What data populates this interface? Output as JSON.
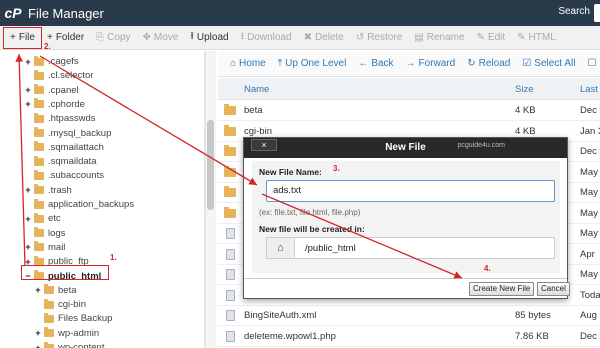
{
  "header": {
    "logo": "cP",
    "title": "File Manager",
    "search_label": "Search"
  },
  "toolbar": {
    "buttons": [
      {
        "icon": "plus-icon",
        "glyph": "+",
        "label": "File",
        "enabled": true
      },
      {
        "icon": "plus-icon",
        "glyph": "+",
        "label": "Folder",
        "enabled": true
      },
      {
        "icon": "copy-icon",
        "glyph": "⎘",
        "label": "Copy",
        "enabled": false
      },
      {
        "icon": "move-icon",
        "glyph": "✥",
        "label": "Move",
        "enabled": false
      },
      {
        "icon": "upload-icon",
        "glyph": "⭱",
        "label": "Upload",
        "enabled": true
      },
      {
        "icon": "download-icon",
        "glyph": "⭳",
        "label": "Download",
        "enabled": false
      },
      {
        "icon": "delete-icon",
        "glyph": "✖",
        "label": "Delete",
        "enabled": false
      },
      {
        "icon": "restore-icon",
        "glyph": "↺",
        "label": "Restore",
        "enabled": false
      },
      {
        "icon": "rename-icon",
        "glyph": "▤",
        "label": "Rename",
        "enabled": false
      },
      {
        "icon": "edit-icon",
        "glyph": "✎",
        "label": "Edit",
        "enabled": false
      },
      {
        "icon": "html-editor-icon",
        "glyph": "✎",
        "label": "HTML",
        "enabled": false
      }
    ]
  },
  "sidebar": {
    "items": [
      {
        "label": ".cagefs",
        "expander": "+",
        "depth": 1
      },
      {
        "label": ".cl.selector",
        "expander": "",
        "depth": 1
      },
      {
        "label": ".cpanel",
        "expander": "+",
        "depth": 1
      },
      {
        "label": ".cphorde",
        "expander": "+",
        "depth": 1
      },
      {
        "label": ".htpasswds",
        "expander": "",
        "depth": 1
      },
      {
        "label": ".mysql_backup",
        "expander": "",
        "depth": 1
      },
      {
        "label": ".sqmailattach",
        "expander": "",
        "depth": 1
      },
      {
        "label": ".sqmaildata",
        "expander": "",
        "depth": 1
      },
      {
        "label": ".subaccounts",
        "expander": "",
        "depth": 1
      },
      {
        "label": ".trash",
        "expander": "+",
        "depth": 1
      },
      {
        "label": "application_backups",
        "expander": "",
        "depth": 1
      },
      {
        "label": "etc",
        "expander": "+",
        "depth": 1
      },
      {
        "label": "logs",
        "expander": "",
        "depth": 1
      },
      {
        "label": "mail",
        "expander": "+",
        "depth": 1
      },
      {
        "label": "public_ftp",
        "expander": "+",
        "depth": 1
      },
      {
        "label": "public_html",
        "expander": "−",
        "depth": 1,
        "selected": true
      },
      {
        "label": "beta",
        "expander": "+",
        "depth": 2
      },
      {
        "label": "cgi-bin",
        "expander": "",
        "depth": 2
      },
      {
        "label": "Files Backup",
        "expander": "",
        "depth": 2
      },
      {
        "label": "wp-admin",
        "expander": "+",
        "depth": 2
      },
      {
        "label": "wp-content",
        "expander": "+",
        "depth": 2
      }
    ]
  },
  "navbar": {
    "buttons": [
      {
        "icon": "home-icon",
        "glyph": "⌂",
        "label": "Home"
      },
      {
        "icon": "up-one-level-icon",
        "glyph": "⤒",
        "label": "Up One Level"
      },
      {
        "icon": "back-arrow-icon",
        "glyph": "←",
        "label": "Back"
      },
      {
        "icon": "forward-arrow-icon",
        "glyph": "→",
        "label": "Forward"
      },
      {
        "icon": "reload-icon",
        "glyph": "↻",
        "label": "Reload"
      },
      {
        "icon": "select-all-icon",
        "glyph": "☑",
        "label": "Select All"
      },
      {
        "icon": "unselect-icon",
        "glyph": "☐",
        "label": ""
      }
    ]
  },
  "table": {
    "columns": {
      "name": "Name",
      "size": "Size",
      "date": "Last"
    },
    "rows": [
      {
        "type": "folder",
        "name": "beta",
        "size": "4 KB",
        "date": "Dec"
      },
      {
        "type": "folder",
        "name": "cgi-bin",
        "size": "4 KB",
        "date": "Jan 3"
      },
      {
        "type": "folder",
        "name": "",
        "size": "",
        "date": "Dec"
      },
      {
        "type": "folder",
        "name": "",
        "size": "",
        "date": "May"
      },
      {
        "type": "folder",
        "name": "",
        "size": "",
        "date": "May"
      },
      {
        "type": "folder",
        "name": "",
        "size": "",
        "date": "May"
      },
      {
        "type": "file",
        "name": "",
        "size": "",
        "date": "May"
      },
      {
        "type": "file",
        "name": "",
        "size": "",
        "date": "Apr"
      },
      {
        "type": "file",
        "name": "",
        "size": "",
        "date": "May"
      },
      {
        "type": "file",
        "name": "",
        "size": "",
        "date": "Toda"
      },
      {
        "type": "file",
        "name": "BingSiteAuth.xml",
        "size": "85 bytes",
        "date": "Aug"
      },
      {
        "type": "file",
        "name": "deleteme.wpowl1.php",
        "size": "7.86 KB",
        "date": "Dec"
      }
    ]
  },
  "modal": {
    "title": "New File",
    "watermark": "pcguide4u.com",
    "close_label": "×",
    "name_label": "New File Name:",
    "name_value": "ads.txt",
    "hint": "(ex: file.txt, file.html, file.php)",
    "dir_label": "New file will be created in:",
    "dir_value": "/public_html",
    "create_button": "Create New File",
    "cancel_button": "Cancel"
  },
  "annotations": {
    "step1": "1.",
    "step2": "2.",
    "step3": "3.",
    "step4": "4.",
    "color": "#d4262a"
  }
}
